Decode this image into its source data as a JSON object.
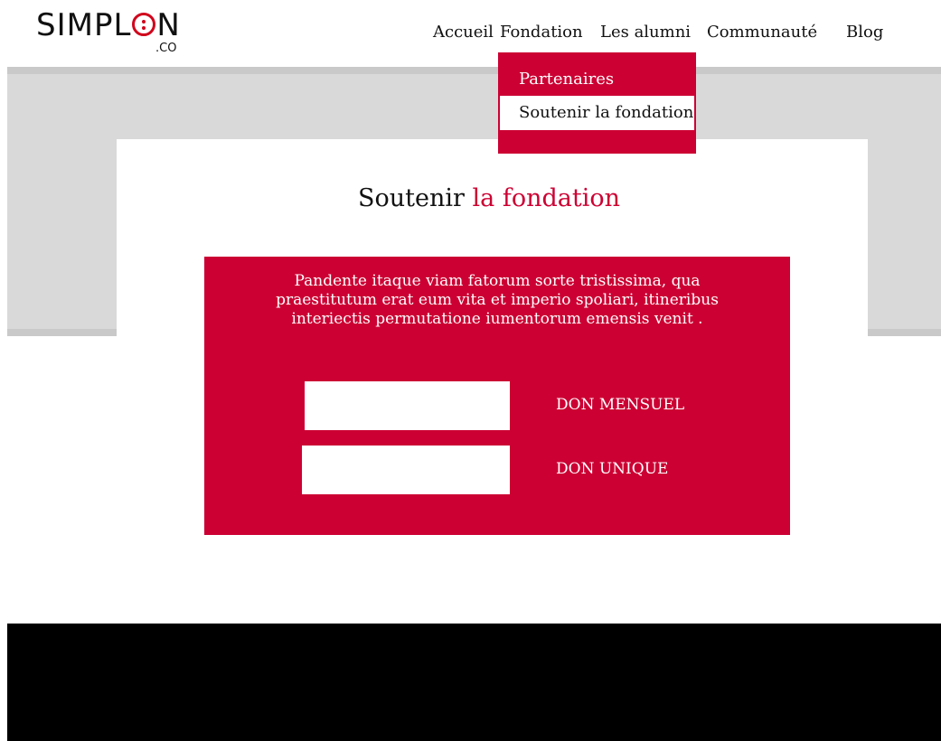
{
  "logo": {
    "text_pre": "SIMPL",
    "text_post": "N",
    "sub": ".CO"
  },
  "nav": {
    "items": [
      {
        "label": "Accueil"
      },
      {
        "label": "Fondation"
      },
      {
        "label": "Les alumni"
      },
      {
        "label": "Communauté"
      },
      {
        "label": "Blog"
      }
    ]
  },
  "dropdown": {
    "items": [
      {
        "label": "Partenaires"
      },
      {
        "label": "Soutenir la fondation"
      }
    ]
  },
  "page": {
    "title_main": "Soutenir",
    "title_accent": "la fondation",
    "description": "Pandente itaque viam fatorum sorte tristissima, qua praestitutum erat eum vita et imperio spoliari, itineribus interiectis permutatione iumentorum emensis venit .",
    "monthly_label": "DON MENSUEL",
    "unique_label": "DON UNIQUE",
    "monthly_value": "",
    "unique_value": ""
  },
  "colors": {
    "accent": "#cc0033",
    "grey_band": "#d9d9d9",
    "footer": "#000000"
  }
}
